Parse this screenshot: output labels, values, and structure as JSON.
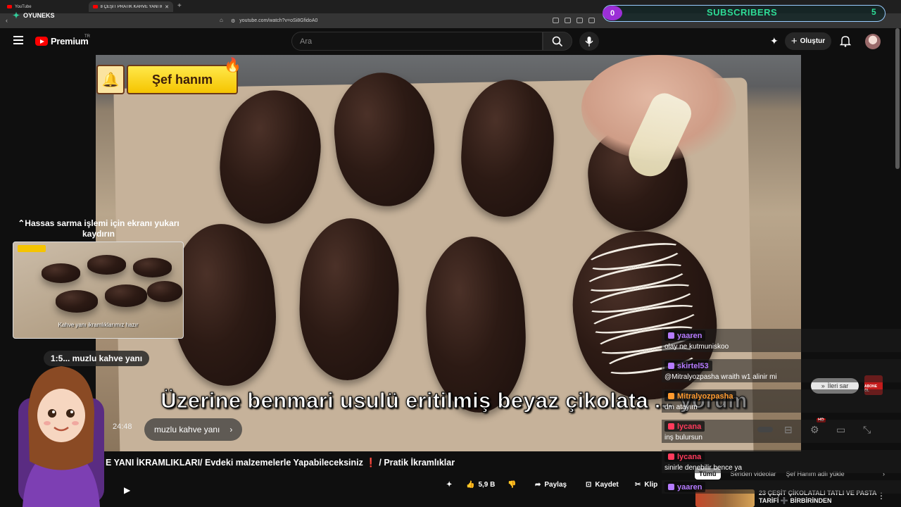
{
  "browser": {
    "tabs": [
      {
        "label": "YouTube",
        "active": false
      },
      {
        "label": "8 ÇEŞİT PRATİK KAHVE YANI İKR",
        "active": true
      }
    ],
    "new_tab": "+",
    "url": "youtube.com/watch?v=oSi8GfidoA0"
  },
  "overlay": {
    "brand": "OYUNEKS",
    "subscribers_count": "0",
    "subscribers_label": "SUBSCRIBERS",
    "subscribers_goal": "5"
  },
  "youtube": {
    "logo": "Premium",
    "country": "TR",
    "search_placeholder": "Ara",
    "create_label": "Oluştur"
  },
  "video": {
    "badge_text": "Şef hanım",
    "caption": "Üzerine benmari usulü eritilmiş beyaz çikolata ... yorum",
    "scroll_hint": "⌃Hassas sarma işlemi için ekranı yukarı kaydırın",
    "thumb_caption": "Kahve yanı ikramlıklarımız hazır",
    "chapter_top": "1:5... muzlu kahve yanı",
    "time": "24:48",
    "chapter": "muzlu kahve yanı",
    "title": "E YANI İKRAMLIKLARI/ Evdeki malzemelerle Yapabileceksiniz ❗ / Pratik İkramlıklar"
  },
  "actions": {
    "likes": "5,9 B",
    "share": "Paylaş",
    "save": "Kaydet",
    "clip": "Klip"
  },
  "player": {
    "ileri_sar": "İleri sar",
    "abone": "ABONE OL",
    "hd": "HD"
  },
  "next": {
    "tabs": [
      "Tümü",
      "Seriden videolar",
      "Şef Hanım adlı yükle"
    ],
    "related_title": "23 ÇEŞİT ÇİKOLATALI TATLI VE PASTA TARİFİ ➕ BİRBİRİNDEN"
  },
  "chat": [
    {
      "name": "yaaren",
      "text": "olay ne kutmuniskoo",
      "color": "#b57bff"
    },
    {
      "name": "skirtel53",
      "text": "@Mitralyozpasha wraith w1 alinir mi",
      "color": "#b57bff"
    },
    {
      "name": "Mitralyozpasha",
      "text": "dm atayım",
      "color": "#ff9a2e"
    },
    {
      "name": "lycana",
      "text": "inş bulursun",
      "color": "#ff3b5c"
    },
    {
      "name": "lycana",
      "text": "sinirle denebilir bence ya",
      "color": "#ff3b5c"
    },
    {
      "name": "yaaren",
      "text": "",
      "color": "#b57bff"
    }
  ],
  "colors": {
    "accent": "#ff0000",
    "subs_green": "#2edc96",
    "subs_purple": "#9b2fd6"
  }
}
